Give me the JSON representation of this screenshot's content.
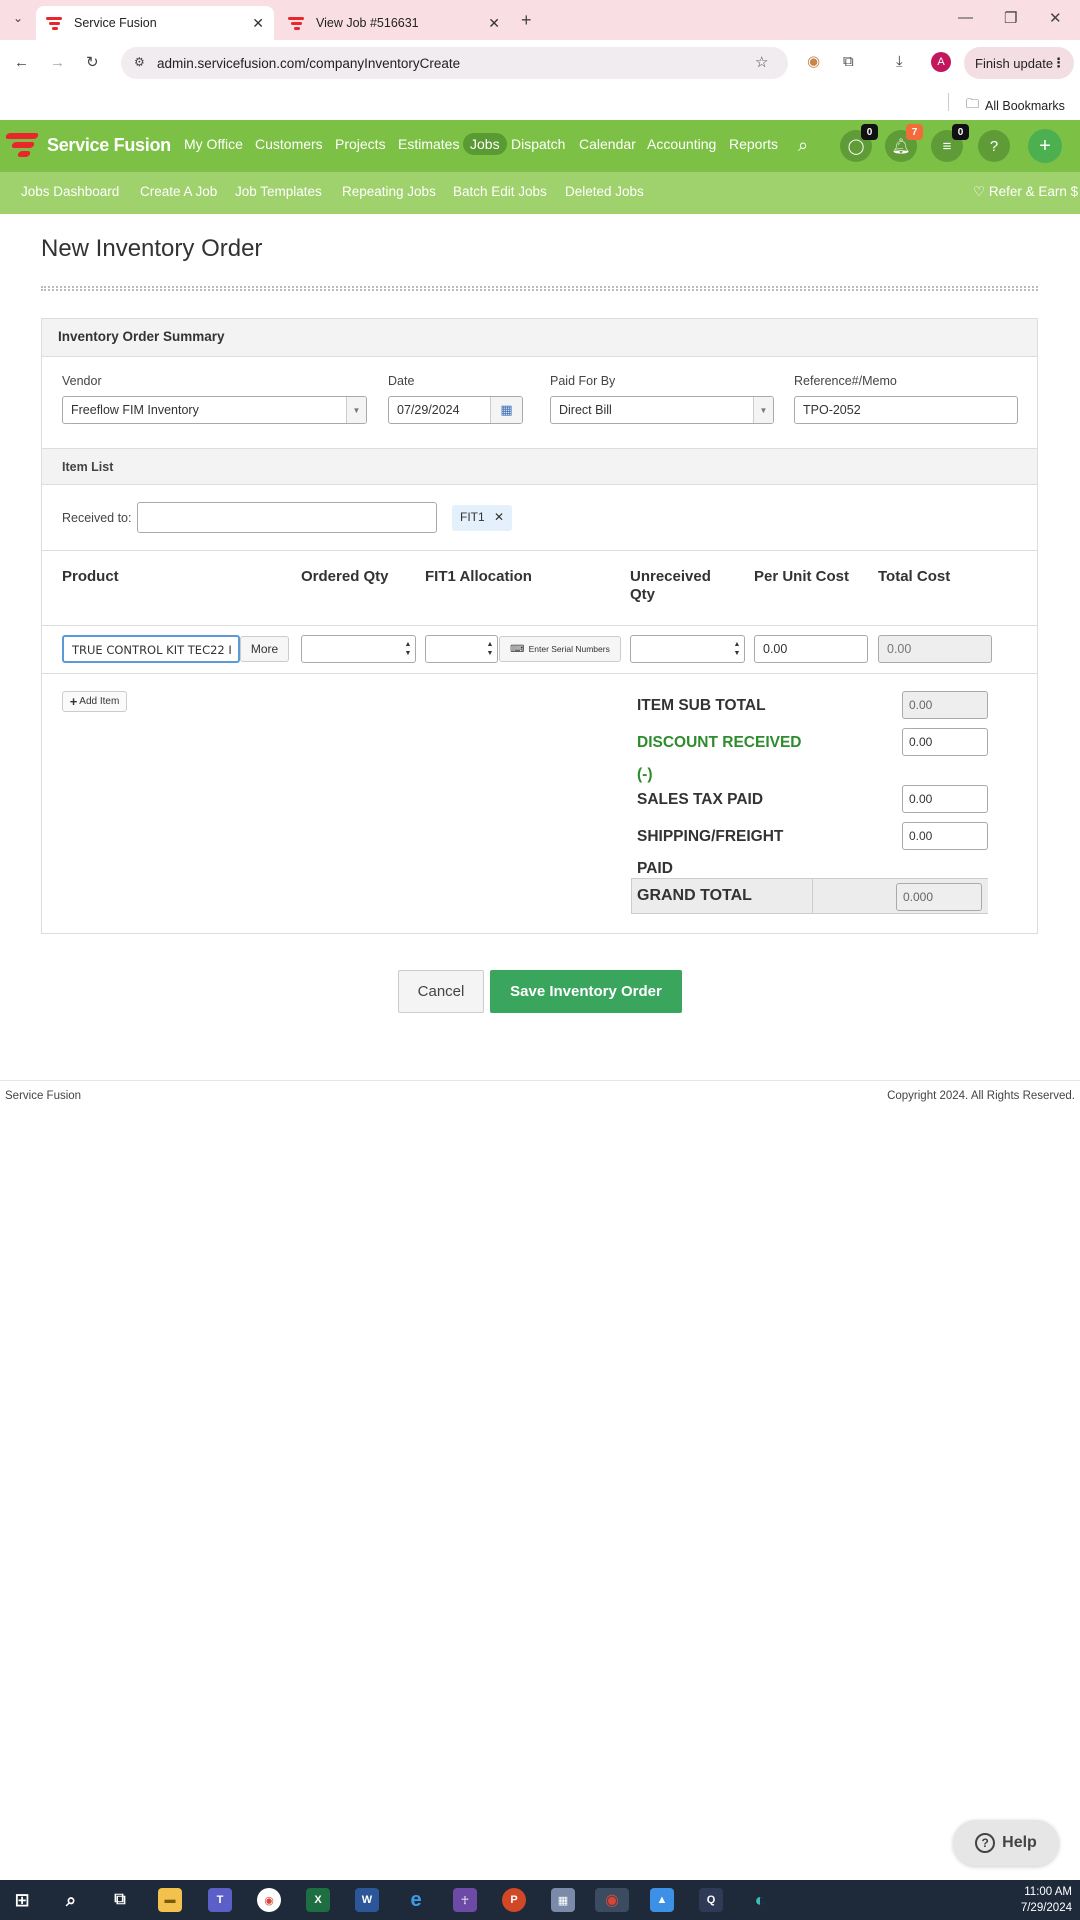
{
  "browser": {
    "tabs": [
      {
        "title": "Service Fusion"
      },
      {
        "title": "View Job #516631"
      }
    ],
    "url": "admin.servicefusion.com/companyInventoryCreate",
    "finish_update": "Finish update",
    "bookmarks": "All Bookmarks",
    "profile_initial": "A"
  },
  "app": {
    "brand": "Service Fusion",
    "nav": [
      "My Office",
      "Customers",
      "Projects",
      "Estimates",
      "Jobs",
      "Dispatch",
      "Calendar",
      "Accounting",
      "Reports"
    ],
    "active_nav": "Jobs",
    "badges": {
      "chat": "0",
      "notifications": "7",
      "tasks": "0"
    },
    "subnav": [
      "Jobs Dashboard",
      "Create A Job",
      "Job Templates",
      "Repeating Jobs",
      "Batch Edit Jobs",
      "Deleted Jobs"
    ],
    "refer": "Refer & Earn $"
  },
  "page": {
    "title": "New Inventory Order",
    "summary_title": "Inventory Order Summary",
    "vendor_label": "Vendor",
    "vendor_value": "Freeflow FIM Inventory",
    "date_label": "Date",
    "date_value": "07/29/2024",
    "paid_label": "Paid For By",
    "paid_value": "Direct Bill",
    "ref_label": "Reference#/Memo",
    "ref_value": "TPO-2052",
    "item_list_title": "Item List",
    "received_label": "Received to:",
    "received_value": "",
    "tag": "FIT1",
    "columns": {
      "product": "Product",
      "ordered": "Ordered Qty",
      "allocation": "FIT1 Allocation",
      "unreceived_1": "Unreceived",
      "unreceived_2": "Qty",
      "unit_cost": "Per Unit Cost",
      "total_cost": "Total Cost"
    },
    "row": {
      "product": "TRUE CONTROL KIT TEC22 I",
      "more": "More",
      "ordered": "",
      "allocation": "",
      "serial_btn": "Enter Serial Numbers",
      "unreceived": "",
      "unit_cost": "0.00",
      "total_cost": "0.00"
    },
    "add_item": "Add Item",
    "totals": {
      "subtotal_label": "ITEM SUB TOTAL",
      "subtotal": "0.00",
      "discount_label": "DISCOUNT RECEIVED",
      "discount_sign": "(-)",
      "discount": "0.00",
      "tax_label": "SALES TAX PAID",
      "tax": "0.00",
      "shipping_label_1": "SHIPPING/FREIGHT",
      "shipping_label_2": "PAID",
      "shipping": "0.00",
      "grand_label": "GRAND TOTAL",
      "grand": "0.000"
    },
    "cancel": "Cancel",
    "save": "Save Inventory Order"
  },
  "footer": {
    "left": "Service Fusion",
    "right": "Copyright 2024. All Rights Reserved."
  },
  "help": "Help",
  "taskbar": {
    "time": "11:00 AM",
    "date": "7/29/2024"
  }
}
